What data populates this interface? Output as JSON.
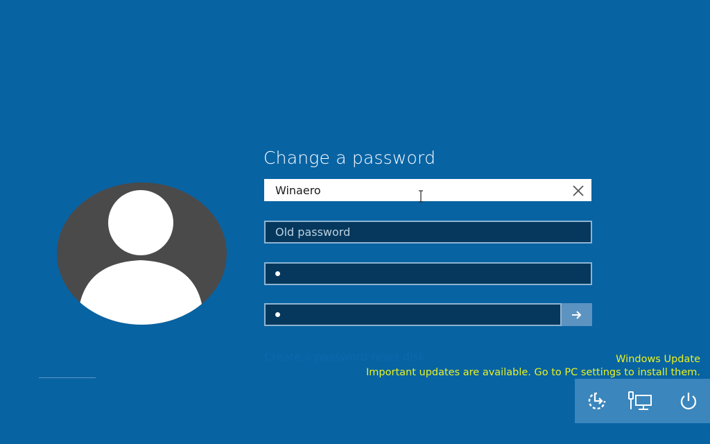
{
  "dialog": {
    "title": "Change a password",
    "username_value": "Winaero",
    "old_password_placeholder": "Old password",
    "reset_link": "Create a password reset disk"
  },
  "notification": {
    "title": "Windows Update",
    "message": "Important updates are available. Go to PC settings to install them."
  },
  "icons": {
    "clear": "close-icon",
    "submit": "arrow-right-icon",
    "ease_of_access": "ease-of-access-icon",
    "network": "network-icon",
    "power": "power-icon"
  },
  "colors": {
    "background": "#0863a3",
    "accent": "#5d93c0",
    "notification_text": "#e7f222"
  }
}
